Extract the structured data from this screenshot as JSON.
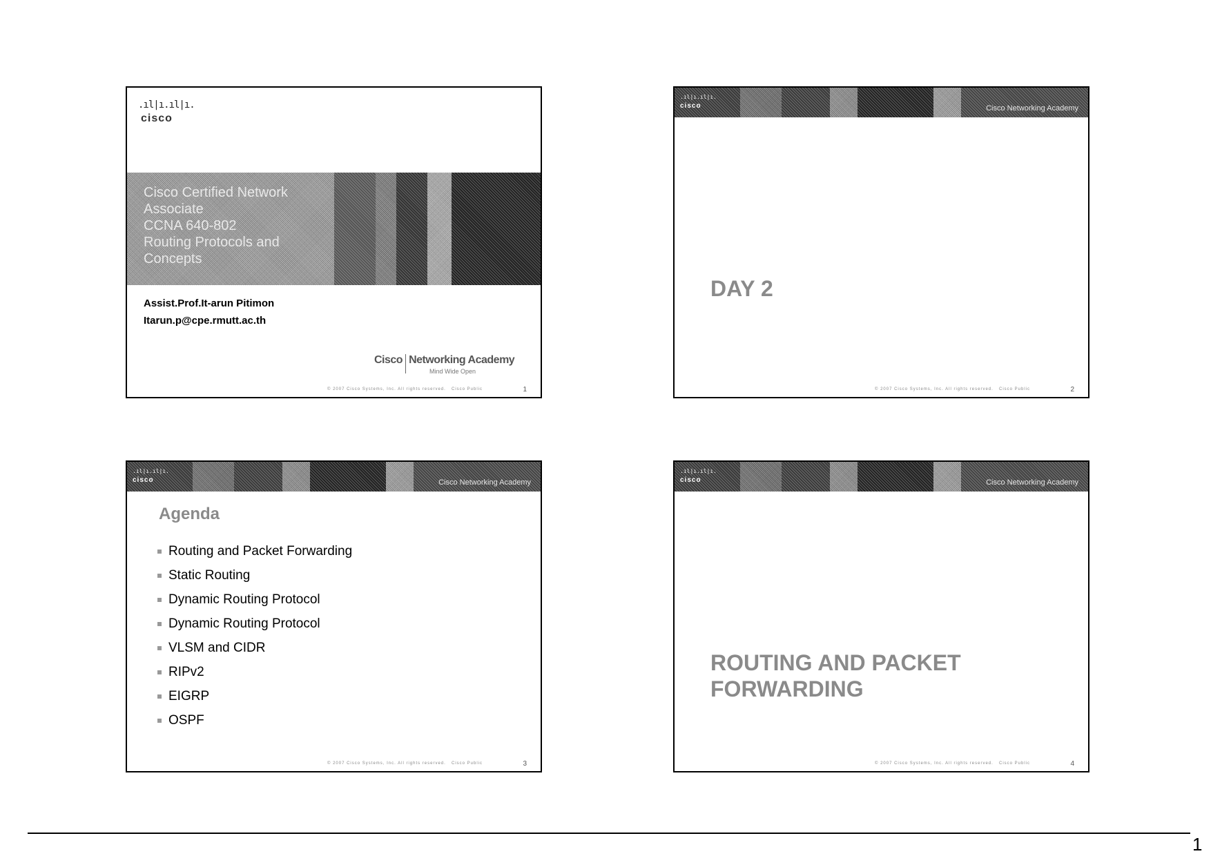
{
  "page": {
    "number": "1"
  },
  "slides": [
    {
      "index": 1,
      "logo": {
        "bars": ".ıl|ı.ıl|ı.",
        "word": "cisco"
      },
      "title_lines": [
        "Cisco Certified Network",
        "Associate",
        "CCNA 640-802",
        "Routing Protocols and",
        "Concepts"
      ],
      "author": "Assist.Prof.It-arun  Pitimon",
      "email": "Itarun.p@cpe.rmutt.ac.th",
      "academy": {
        "left": "Cisco",
        "right": "Networking Academy",
        "tagline": "Mind Wide Open"
      },
      "footer": {
        "left": "© 2007 Cisco Systems, Inc. All rights reserved.",
        "right": "Cisco Public",
        "slide_number": "1"
      }
    },
    {
      "index": 2,
      "banner": {
        "logo_bars": ".ıl|ı.ıl|ı.",
        "logo_word": "cisco",
        "academy": "Cisco Networking Academy"
      },
      "title": "DAY 2",
      "footer": {
        "left": "© 2007 Cisco Systems, Inc. All rights reserved.",
        "right": "Cisco Public",
        "slide_number": "2"
      }
    },
    {
      "index": 3,
      "banner": {
        "logo_bars": ".ıl|ı.ıl|ı.",
        "logo_word": "cisco",
        "academy": "Cisco Networking Academy"
      },
      "title": "Agenda",
      "items": [
        "Routing and Packet Forwarding",
        "Static Routing",
        "Dynamic Routing Protocol",
        "Dynamic Routing Protocol",
        "VLSM and CIDR",
        "RIPv2",
        "EIGRP",
        "OSPF"
      ],
      "footer": {
        "left": "© 2007 Cisco Systems, Inc. All rights reserved.",
        "right": "Cisco Public",
        "slide_number": "3"
      }
    },
    {
      "index": 4,
      "banner": {
        "logo_bars": ".ıl|ı.ıl|ı.",
        "logo_word": "cisco",
        "academy": "Cisco Networking Academy"
      },
      "title_lines": [
        "ROUTING AND PACKET",
        "FORWARDING"
      ],
      "footer": {
        "left": "© 2007 Cisco Systems, Inc. All rights reserved.",
        "right": "Cisco Public",
        "slide_number": "4"
      }
    }
  ]
}
